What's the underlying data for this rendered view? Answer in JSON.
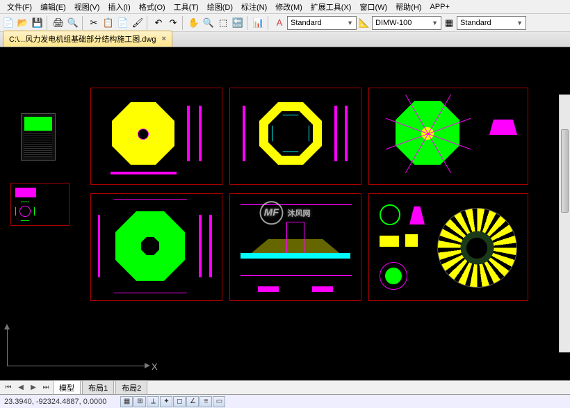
{
  "menu": {
    "file": "文件(F)",
    "edit": "编辑(E)",
    "view": "视图(V)",
    "insert": "插入(I)",
    "format": "格式(O)",
    "tools": "工具(T)",
    "draw": "绘图(D)",
    "annotate": "标注(N)",
    "modify": "修改(M)",
    "exttools": "扩展工具(X)",
    "window": "窗口(W)",
    "help": "帮助(H)",
    "appplus": "APP+"
  },
  "dropdowns": {
    "style1": "Standard",
    "dimstyle": "DIMW-100",
    "style2": "Standard"
  },
  "tab": {
    "filename": "C:\\...风力发电机组基础部分结构施工图.dwg"
  },
  "axis": {
    "x": "X"
  },
  "layoutTabs": {
    "model": "模型",
    "layout1": "布局1",
    "layout2": "布局2"
  },
  "status": {
    "coords": "23.3940, -92324.4887, 0.0000"
  },
  "watermark": {
    "logo": "MF",
    "text": "沐风网"
  }
}
